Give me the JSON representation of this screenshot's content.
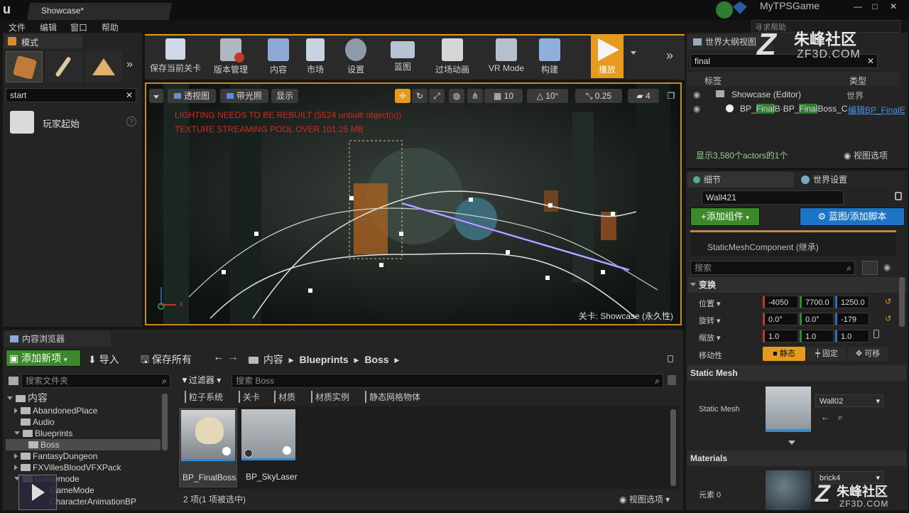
{
  "window": {
    "tab_title": "Showcase*",
    "project_name": "MyTPSGame",
    "search_help_placeholder": "寻求帮助"
  },
  "menu": [
    "文件",
    "编辑",
    "窗口",
    "帮助"
  ],
  "modes": {
    "tab_label": "模式",
    "search_value": "start",
    "result_label": "玩家起始"
  },
  "toolbar": {
    "items": [
      {
        "label": "保存当前关卡",
        "icon": "save-icon"
      },
      {
        "label": "版本管理",
        "icon": "source-control-icon"
      },
      {
        "label": "内容",
        "icon": "content-icon"
      },
      {
        "label": "市场",
        "icon": "marketplace-icon"
      },
      {
        "label": "设置",
        "icon": "settings-icon"
      },
      {
        "label": "蓝图",
        "icon": "blueprint-icon"
      },
      {
        "label": "过场动画",
        "icon": "cinematics-icon"
      },
      {
        "label": "VR Mode",
        "icon": "vr-icon"
      },
      {
        "label": "构建",
        "icon": "build-icon"
      },
      {
        "label": "播放",
        "icon": "play-icon"
      }
    ]
  },
  "viewport": {
    "perspective_label": "透视图",
    "lit_label": "带光照",
    "show_label": "显示",
    "grid_value": "10",
    "rotation_value": "10°",
    "scale_value": "0.25",
    "camera_speed": "4",
    "warning_lighting": "LIGHTING NEEDS TO BE REBUILT (5524 unbuilt object(s))",
    "warning_texture": "TEXTURE STREAMING POOL OVER 101.25 MB",
    "level_label": "关卡:",
    "level_name": "Showcase (永久性)",
    "axis_x": "x"
  },
  "outliner": {
    "tab_label": "世界大纲视图",
    "search_value": "final",
    "col_label": "标签",
    "col_type": "类型",
    "rows": [
      {
        "name": "Showcase (Editor)",
        "type": "世界"
      },
      {
        "name_pre": "BP_",
        "name_hl1": "Final",
        "name_mid": "B·BP_",
        "name_hl2": "Final",
        "name_post": "Boss_C",
        "type": "编辑BP_FinalE"
      }
    ],
    "footer_count": "显示3,580个actors的1个",
    "view_options": "视图选项"
  },
  "details": {
    "tab_details": "细节",
    "tab_world_settings": "世界设置",
    "actor_name": "Wall421",
    "add_component": "+添加组件",
    "blueprint_button": "蓝图/添加脚本",
    "component_row": "StaticMeshComponent (继承)",
    "search_placeholder": "搜索",
    "transform_header": "变换",
    "location_label": "位置",
    "location": [
      "-4050",
      "7700.0",
      "1250.0"
    ],
    "rotation_label": "旋转",
    "rotation": [
      "0.0°",
      "0.0°",
      "-179"
    ],
    "scale_label": "缩放",
    "scale": [
      "1.0",
      "1.0",
      "1.0"
    ],
    "mobility_label": "移动性",
    "mobility_static": "静态",
    "mobility_stationary": "固定",
    "mobility_movable": "可移",
    "static_mesh_header": "Static Mesh",
    "static_mesh_label": "Static Mesh",
    "static_mesh_value": "Wall02",
    "materials_header": "Materials",
    "element_label": "元素 0",
    "material_value": "brick4"
  },
  "content_browser": {
    "tab_label": "内容浏览器",
    "add_new": "添加新项",
    "import": "导入",
    "save_all": "保存所有",
    "breadcrumb": [
      "内容",
      "Blueprints",
      "Boss"
    ],
    "folder_search_placeholder": "搜索文件夹",
    "filters_label": "过滤器",
    "asset_search_placeholder": "搜索 Boss",
    "filter_chips": [
      "粒子系统",
      "关卡",
      "材质",
      "材质实例",
      "静态网格物体"
    ],
    "tree": [
      {
        "label": "内容",
        "depth": 0,
        "expanded": true
      },
      {
        "label": "AbandonedPlace",
        "depth": 1,
        "expanded": false
      },
      {
        "label": "Audio",
        "depth": 1,
        "expanded": null
      },
      {
        "label": "Blueprints",
        "depth": 1,
        "expanded": true
      },
      {
        "label": "Boss",
        "depth": 2,
        "expanded": null,
        "selected": true
      },
      {
        "label": "FantasyDungeon",
        "depth": 1,
        "expanded": false
      },
      {
        "label": "FXVillesBloodVFXPack",
        "depth": 1,
        "expanded": false
      },
      {
        "label": "Gamemode",
        "depth": 1,
        "expanded": true
      },
      {
        "label": "GameMode",
        "depth": 2,
        "expanded": null
      },
      {
        "label": "CharacterAnimationBP",
        "depth": 2,
        "expanded": null
      }
    ],
    "assets": [
      {
        "label": "BP_FinalBoss"
      },
      {
        "label": "BP_SkyLaser"
      }
    ],
    "status": "2 项(1 项被选中)",
    "view_options": "视图选项"
  },
  "watermark": {
    "text_cn": "朱峰社区",
    "text_en": "ZF3D.COM"
  },
  "colors": {
    "accent_orange": "#e69b1e",
    "selected_blue": "#1c74c9",
    "green_button": "#3a8a2a",
    "warning_red": "#d42a1a"
  }
}
